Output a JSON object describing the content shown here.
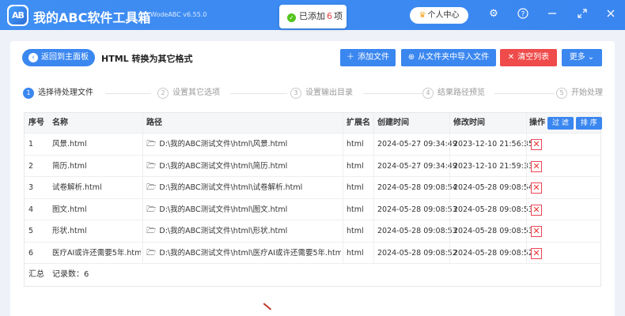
{
  "app": {
    "logo_text": "AB",
    "title": "我的ABC软件工具箱",
    "version": "WodeABC v6.55.0",
    "user_center": "个人中心"
  },
  "toast": {
    "prefix": "已添加",
    "count": "6",
    "suffix": "项"
  },
  "toolbar": {
    "back_label": "返回到主面板",
    "page_title": "HTML 转换为其它格式",
    "add_file": "添加文件",
    "import_folder": "从文件夹中导入文件",
    "clear_list": "清空列表",
    "more": "更多"
  },
  "steps": [
    {
      "num": "1",
      "label": "选择待处理文件"
    },
    {
      "num": "2",
      "label": "设置其它选项"
    },
    {
      "num": "3",
      "label": "设置输出目录"
    },
    {
      "num": "4",
      "label": "结果路径预览"
    },
    {
      "num": "5",
      "label": "开始处理"
    }
  ],
  "table": {
    "headers": {
      "index": "序号",
      "name": "名称",
      "path": "路径",
      "ext": "扩展名",
      "created": "创建时间",
      "modified": "修改时间",
      "action": "操作",
      "filter": "过 滤",
      "sort": "排 序"
    },
    "rows": [
      {
        "index": "1",
        "name": "风景.html",
        "path": "D:\\我的ABC测试文件\\html\\风景.html",
        "ext": "html",
        "created": "2024-05-27 09:34:49",
        "modified": "2023-12-10 21:56:35"
      },
      {
        "index": "2",
        "name": "简历.html",
        "path": "D:\\我的ABC测试文件\\html\\简历.html",
        "ext": "html",
        "created": "2024-05-27 09:34:49",
        "modified": "2023-12-10 21:59:33"
      },
      {
        "index": "3",
        "name": "试卷解析.html",
        "path": "D:\\我的ABC测试文件\\html\\试卷解析.html",
        "ext": "html",
        "created": "2024-05-28 09:08:54",
        "modified": "2024-05-28 09:08:54"
      },
      {
        "index": "4",
        "name": "图文.html",
        "path": "D:\\我的ABC测试文件\\html\\图文.html",
        "ext": "html",
        "created": "2024-05-28 09:08:53",
        "modified": "2024-05-28 09:08:53"
      },
      {
        "index": "5",
        "name": "形状.html",
        "path": "D:\\我的ABC测试文件\\html\\形状.html",
        "ext": "html",
        "created": "2024-05-28 09:08:53",
        "modified": "2024-05-28 09:08:53"
      },
      {
        "index": "6",
        "name": "医疗AI或许还需要5年.html",
        "path": "D:\\我的ABC测试文件\\html\\医疗AI或许还需要5年.html",
        "ext": "html",
        "created": "2024-05-28 09:08:52",
        "modified": "2024-05-28 09:08:52"
      }
    ],
    "summary_label": "汇总",
    "record_count": "记录数：6"
  },
  "colors": {
    "primary": "#3b87f0",
    "danger": "#ef4b4b",
    "success": "#52c41a"
  },
  "icons": [
    "logo-icon",
    "check-icon",
    "crown-icon",
    "gear-icon",
    "help-icon",
    "minimize-icon",
    "close-icon",
    "chevron-left-icon",
    "plus-icon",
    "folder-import-icon",
    "clear-icon",
    "chevron-down-icon",
    "folder-icon",
    "delete-icon"
  ]
}
